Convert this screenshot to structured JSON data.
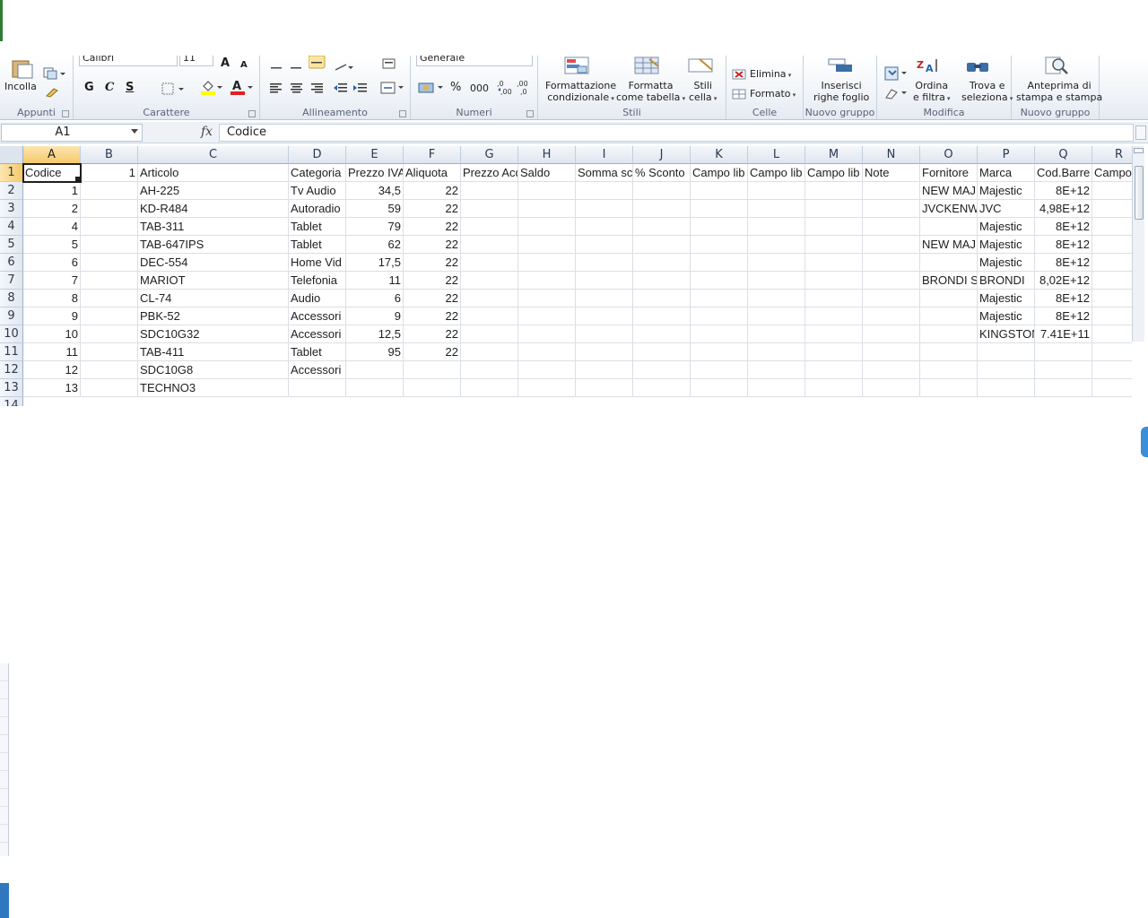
{
  "ribbon": {
    "clipboard": {
      "paste_label": "Incolla",
      "group_label": "Appunti"
    },
    "font": {
      "font_name": "Calibri",
      "font_size": "11",
      "bold": "G",
      "italic": "C",
      "underline": "S",
      "group_label": "Carattere"
    },
    "alignment": {
      "group_label": "Allineamento"
    },
    "numbers": {
      "format": "Generale",
      "percent": "%",
      "thousands": "000",
      "group_label": "Numeri"
    },
    "styles": {
      "cond_format_line1": "Formattazione",
      "cond_format_line2": "condizionale",
      "format_table_line1": "Formatta",
      "format_table_line2": "come tabella",
      "cell_styles_line1": "Stili",
      "cell_styles_line2": "cella",
      "group_label": "Stili"
    },
    "cells": {
      "delete_label": "Elimina",
      "format_label": "Formato",
      "group_label": "Celle"
    },
    "new_group_1": {
      "insert_line1": "Inserisci",
      "insert_line2": "righe foglio",
      "group_label": "Nuovo gruppo"
    },
    "editing": {
      "sort_line1": "Ordina",
      "sort_line2": "e filtra",
      "find_line1": "Trova e",
      "find_line2": "seleziona",
      "group_label": "Modifica"
    },
    "new_group_2": {
      "preview_line1": "Anteprima di",
      "preview_line2": "stampa e stampa",
      "group_label": "Nuovo gruppo"
    }
  },
  "formula_bar": {
    "name_box": "A1",
    "fx": "fx",
    "value": "Codice"
  },
  "sheet": {
    "columns": [
      "A",
      "B",
      "C",
      "D",
      "E",
      "F",
      "G",
      "H",
      "I",
      "J",
      "K",
      "L",
      "M",
      "N",
      "O",
      "P",
      "Q",
      "R"
    ],
    "selected_column": "A",
    "selected_row": "1",
    "row_numbers": [
      "1",
      "2",
      "3",
      "4",
      "5",
      "6",
      "7",
      "8",
      "9",
      "10",
      "11",
      "12",
      "13",
      "14"
    ],
    "rows": [
      [
        "Codice",
        "1",
        "Articolo",
        "Categoria",
        "Prezzo IVA",
        "Aliquota",
        "Prezzo Acq",
        "Saldo",
        "Somma sc",
        "% Sconto",
        "Campo lib",
        "Campo lib",
        "Campo lib",
        "Note",
        "Fornitore",
        "Marca",
        "Cod.Barre",
        "Campo"
      ],
      [
        "1",
        "",
        "AH-225",
        "Tv Audio",
        "34,5",
        "22",
        "",
        "",
        "",
        "",
        "",
        "",
        "",
        "",
        "NEW MAJ",
        "Majestic",
        "8E+12",
        ""
      ],
      [
        "2",
        "",
        "KD-R484",
        "Autoradio",
        "59",
        "22",
        "",
        "",
        "",
        "",
        "",
        "",
        "",
        "",
        "JVCKENW",
        "JVC",
        "4,98E+12",
        ""
      ],
      [
        "4",
        "",
        "TAB-311",
        "Tablet",
        "79",
        "22",
        "",
        "",
        "",
        "",
        "",
        "",
        "",
        "",
        "",
        "Majestic",
        "8E+12",
        ""
      ],
      [
        "5",
        "",
        "TAB-647IPS",
        "Tablet",
        "62",
        "22",
        "",
        "",
        "",
        "",
        "",
        "",
        "",
        "",
        "NEW MAJ",
        "Majestic",
        "8E+12",
        ""
      ],
      [
        "6",
        "",
        "DEC-554",
        "Home Vid",
        "17,5",
        "22",
        "",
        "",
        "",
        "",
        "",
        "",
        "",
        "",
        "",
        "Majestic",
        "8E+12",
        ""
      ],
      [
        "7",
        "",
        "MARIOT",
        "Telefonia",
        "11",
        "22",
        "",
        "",
        "",
        "",
        "",
        "",
        "",
        "",
        "BRONDI S",
        "BRONDI",
        "8,02E+12",
        ""
      ],
      [
        "8",
        "",
        "CL-74",
        "Audio",
        "6",
        "22",
        "",
        "",
        "",
        "",
        "",
        "",
        "",
        "",
        "",
        "Majestic",
        "8E+12",
        ""
      ],
      [
        "9",
        "",
        "PBK-52",
        "Accessori",
        "9",
        "22",
        "",
        "",
        "",
        "",
        "",
        "",
        "",
        "",
        "",
        "Majestic",
        "8E+12",
        ""
      ],
      [
        "10",
        "",
        "SDC10G32",
        "Accessori",
        "12,5",
        "22",
        "",
        "",
        "",
        "",
        "",
        "",
        "",
        "",
        "",
        "KINGSTON",
        "7.41E+11",
        ""
      ],
      [
        "11",
        "",
        "TAB-411",
        "Tablet",
        "95",
        "22",
        "",
        "",
        "",
        "",
        "",
        "",
        "",
        "",
        "",
        "",
        "",
        ""
      ],
      [
        "12",
        "",
        "SDC10G8",
        "Accessori",
        "",
        "",
        "",
        "",
        "",
        "",
        "",
        "",
        "",
        "",
        "",
        "",
        "",
        ""
      ],
      [
        "13",
        "",
        "TECHNO3",
        "",
        "",
        "",
        "",
        "",
        "",
        "",
        "",
        "",
        "",
        "",
        "",
        "",
        "",
        ""
      ]
    ]
  },
  "colors": {
    "selected_header": "#f5c96b",
    "grid_line": "#dadfe6",
    "header_bg": "#dfe6ef",
    "accent_blue": "#3a8fd8"
  }
}
